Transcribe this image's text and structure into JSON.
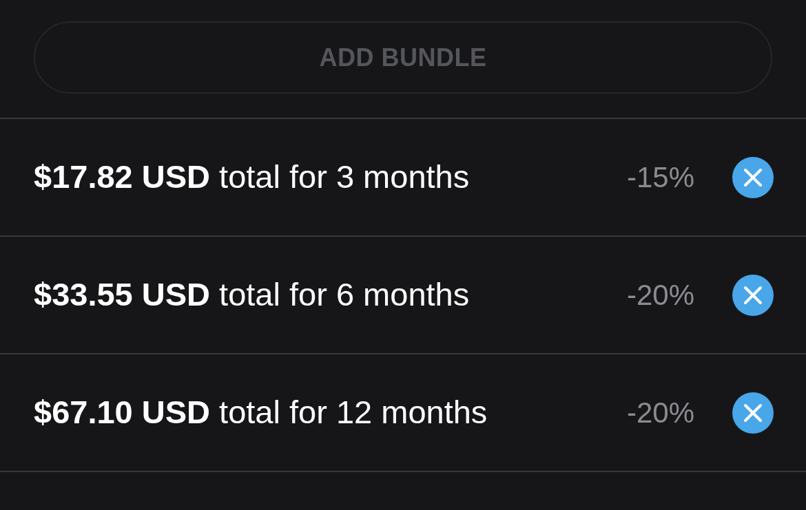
{
  "add_bundle_button": {
    "label": "ADD BUNDLE",
    "disabled": true
  },
  "bundles": [
    {
      "description": "**$17.82 USD** total for 3 months",
      "discount": "-15%"
    },
    {
      "description": "**$33.55 USD** total for 6 months",
      "discount": "-20%"
    },
    {
      "description": "**$67.10 USD** total for 12 months",
      "discount": "-20%"
    }
  ]
}
